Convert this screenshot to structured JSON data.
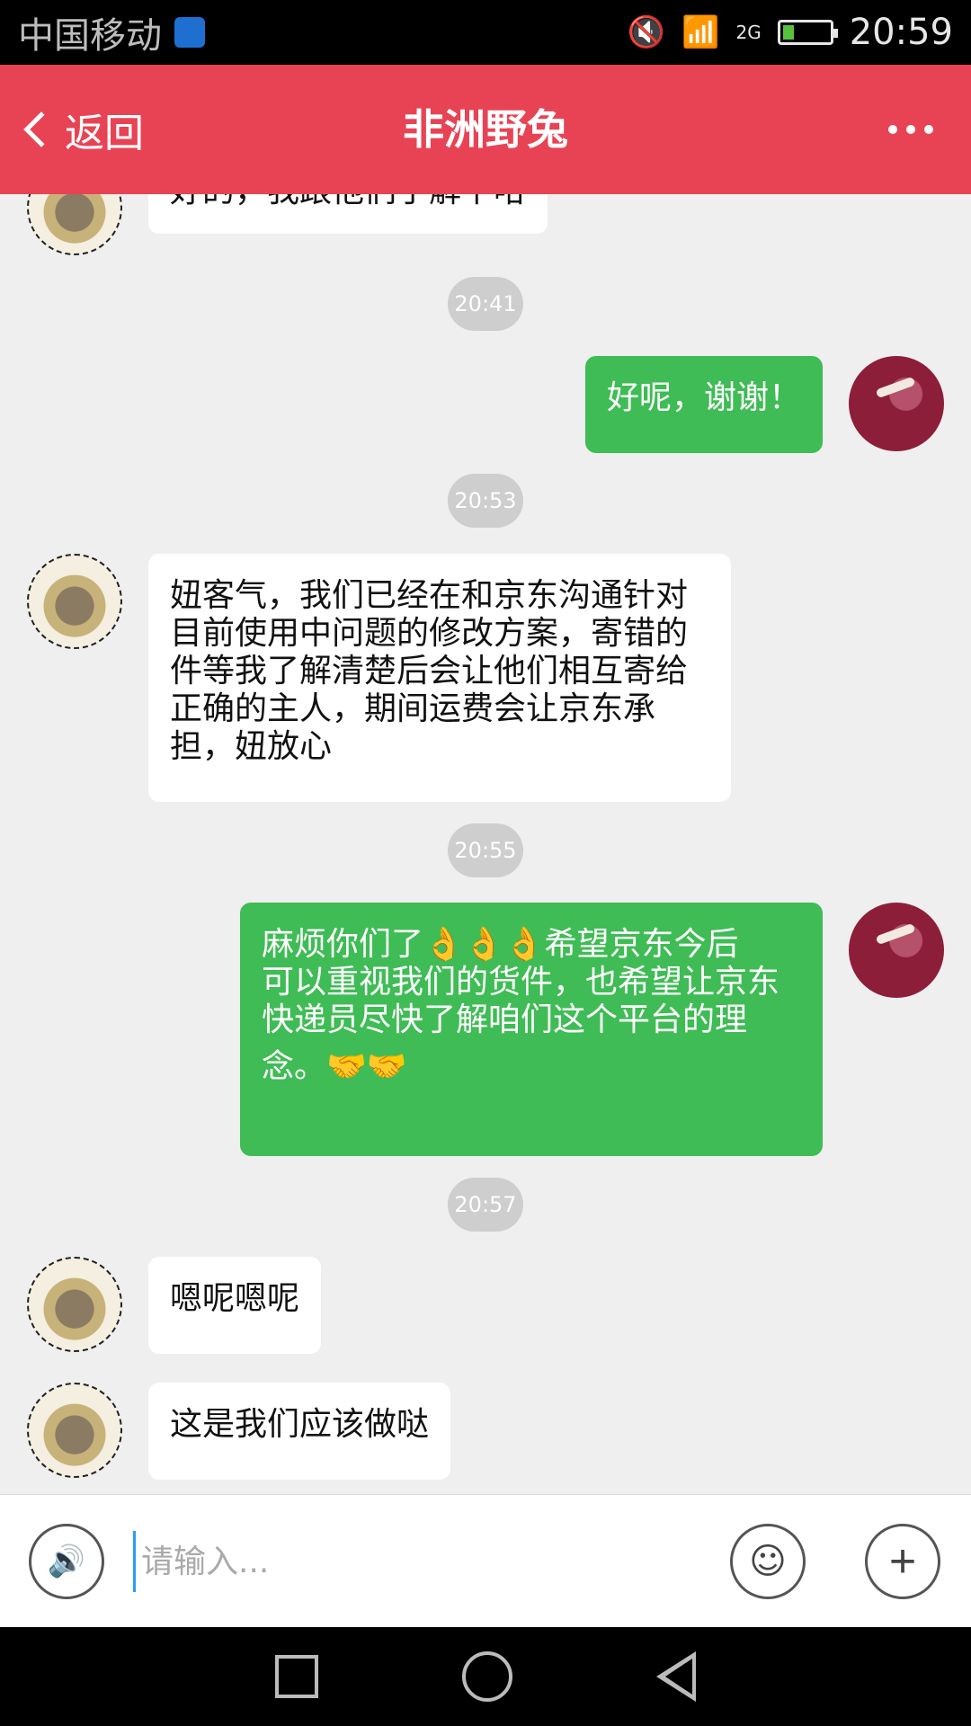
{
  "status_bar": {
    "carrier": "中国移动",
    "network": "2G",
    "time": "20:59"
  },
  "header": {
    "back_label": "返回",
    "title": "非洲野兔",
    "accent_color": "#e84355"
  },
  "messages": [
    {
      "sender": "other",
      "lines": [
        "好的，我跟他们了解下哈"
      ]
    },
    {
      "time": "20:41"
    },
    {
      "sender": "me",
      "lines": [
        "好呢，谢谢！"
      ]
    },
    {
      "time": "20:53"
    },
    {
      "sender": "other",
      "lines": [
        "妞客气，我们已经在和京东沟通针对",
        "目前使用中问题的修改方案，寄错的",
        "件等我了解清楚后会让他们相互寄给",
        "正确的主人，期间运费会让京东承",
        "担，妞放心"
      ]
    },
    {
      "time": "20:55"
    },
    {
      "sender": "me",
      "lines": [
        "麻烦你们了👌👌👌希望京东今后",
        "可以重视我们的货件，也希望让京东",
        "快递员尽快了解咱们这个平台的理",
        "念。🤝🤝"
      ]
    },
    {
      "time": "20:57"
    },
    {
      "sender": "other",
      "lines": [
        "嗯呢嗯呢"
      ]
    },
    {
      "sender": "other",
      "lines": [
        "这是我们应该做哒"
      ]
    }
  ],
  "input": {
    "placeholder": "请输入..."
  },
  "colors": {
    "outgoing_bubble": "#3fbc55",
    "incoming_bubble": "#ffffff"
  }
}
